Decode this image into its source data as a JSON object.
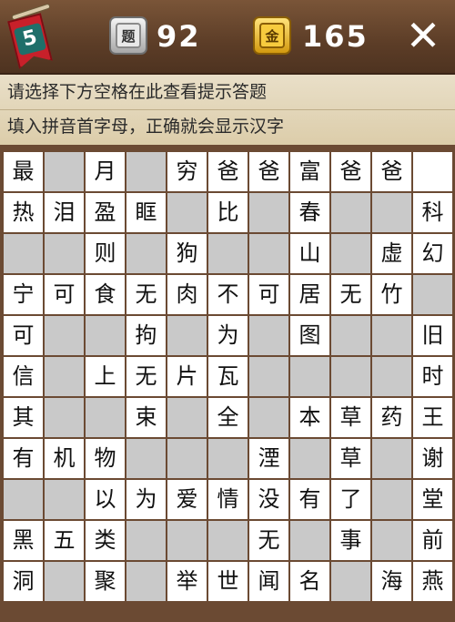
{
  "header": {
    "level": "5",
    "hint_icon_label": "题",
    "hint_count": "92",
    "gold_icon_label": "金",
    "gold_count": "165",
    "close_label": "✕"
  },
  "info": {
    "line1": "请选择下方空格在此查看提示答题",
    "line2": "填入拼音首字母，正确就会显示汉字"
  },
  "colors": {
    "background": "#6b4a33",
    "white_cell": "#ffffff",
    "empty_cell": "#c9c9c9",
    "badge_red": "#c8202a"
  },
  "grid": [
    [
      "最",
      "#",
      "月",
      "#",
      "穷",
      "爸",
      "爸",
      "富",
      "爸",
      "爸",
      "-"
    ],
    [
      "热",
      "泪",
      "盈",
      "眶",
      "#",
      "比",
      "#",
      "春",
      "#",
      "#",
      "科"
    ],
    [
      "#",
      "#",
      "则",
      "#",
      "狗",
      "#",
      "#",
      "山",
      "#",
      "虚",
      "幻"
    ],
    [
      "宁",
      "可",
      "食",
      "无",
      "肉",
      "不",
      "可",
      "居",
      "无",
      "竹",
      "#"
    ],
    [
      "可",
      "#",
      "#",
      "拘",
      "#",
      "为",
      "#",
      "图",
      "#",
      "#",
      "旧"
    ],
    [
      "信",
      "#",
      "上",
      "无",
      "片",
      "瓦",
      "#",
      "#",
      "#",
      "#",
      "时"
    ],
    [
      "其",
      "#",
      "#",
      "束",
      "#",
      "全",
      "#",
      "本",
      "草",
      "药",
      "王"
    ],
    [
      "有",
      "机",
      "物",
      "#",
      "#",
      "#",
      "湮",
      "#",
      "草",
      "#",
      "谢"
    ],
    [
      "#",
      "#",
      "以",
      "为",
      "爱",
      "情",
      "没",
      "有",
      "了",
      "#",
      "堂"
    ],
    [
      "黑",
      "五",
      "类",
      "#",
      "#",
      "#",
      "无",
      "#",
      "事",
      "#",
      "前"
    ],
    [
      "洞",
      "#",
      "聚",
      "#",
      "举",
      "世",
      "闻",
      "名",
      "#",
      "海",
      "燕"
    ]
  ]
}
